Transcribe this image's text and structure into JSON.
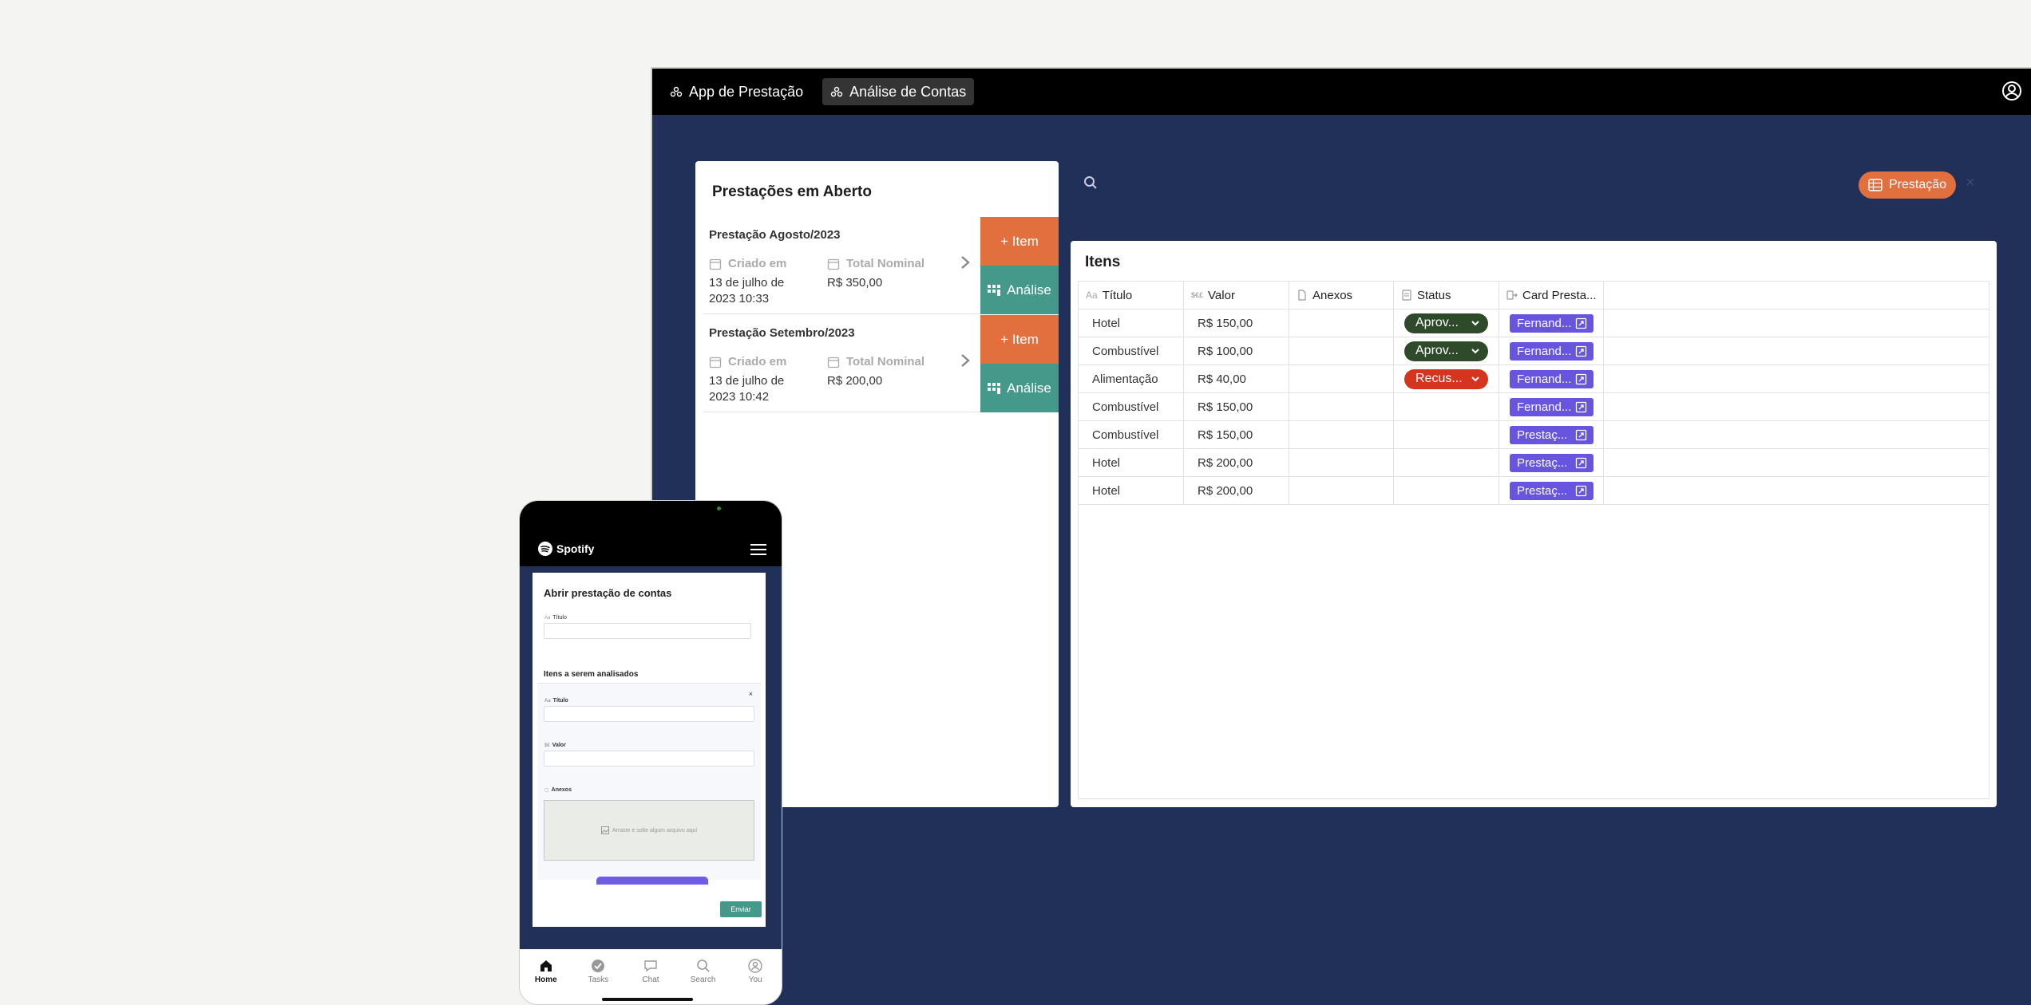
{
  "topbar": {
    "tabs": [
      {
        "label": "App de Prestação"
      },
      {
        "label": "Análise de Contas"
      }
    ]
  },
  "left_panel": {
    "title": "Prestações em Aberto",
    "cards": [
      {
        "title": "Prestação Agosto/2023",
        "created_label": "Criado em",
        "created_value": "13 de julho de 2023 10:33",
        "total_label": "Total Nominal",
        "total_value": "R$ 350,00",
        "item_button": "+ Item",
        "analise_button": "Análise"
      },
      {
        "title": "Prestação Setembro/2023",
        "created_label": "Criado em",
        "created_value": "13 de julho de 2023 10:42",
        "total_label": "Total Nominal",
        "total_value": "R$ 200,00",
        "item_button": "+ Item",
        "analise_button": "Análise"
      }
    ]
  },
  "filter": {
    "chip_label": "Prestação",
    "chip_color": "#e2703f"
  },
  "items_panel": {
    "title": "Itens",
    "columns": [
      "Título",
      "Valor",
      "Anexos",
      "Status",
      "Card Presta..."
    ],
    "rows": [
      {
        "titulo": "Hotel",
        "valor": "R$ 150,00",
        "status": "Aprov...",
        "status_color": "#2e4a2b",
        "card": "Fernand..."
      },
      {
        "titulo": "Combustível",
        "valor": "R$ 100,00",
        "status": "Aprov...",
        "status_color": "#2e4a2b",
        "card": "Fernand..."
      },
      {
        "titulo": "Alimentação",
        "valor": "R$ 40,00",
        "status": "Recus...",
        "status_color": "#d5341f",
        "card": "Fernand..."
      },
      {
        "titulo": "Combustível",
        "valor": "R$ 150,00",
        "status": "",
        "status_color": "",
        "card": "Fernand..."
      },
      {
        "titulo": "Combustível",
        "valor": "R$ 150,00",
        "status": "",
        "status_color": "",
        "card": "Prestaç..."
      },
      {
        "titulo": "Hotel",
        "valor": "R$ 200,00",
        "status": "",
        "status_color": "",
        "card": "Prestaç..."
      },
      {
        "titulo": "Hotel",
        "valor": "R$ 200,00",
        "status": "",
        "status_color": "",
        "card": "Prestaç..."
      }
    ]
  },
  "phone": {
    "brand": "Spotify",
    "form_title": "Abrir prestação de contas",
    "titulo_label": "Título",
    "section_title": "Itens a serem analisados",
    "sub_titulo_label": "Título",
    "sub_valor_label": "Valor",
    "sub_anexos_label": "Anexos",
    "dropzone_text": "Arraste e solte algum arquivo aqui",
    "send_button": "Enviar",
    "nav": [
      {
        "label": "Home"
      },
      {
        "label": "Tasks"
      },
      {
        "label": "Chat"
      },
      {
        "label": "Search"
      },
      {
        "label": "You"
      }
    ]
  }
}
